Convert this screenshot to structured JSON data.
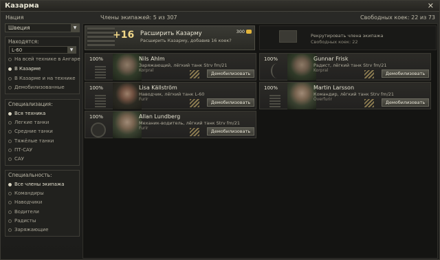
{
  "window": {
    "title": "Казарма",
    "close": "✕"
  },
  "header": {
    "nation_label": "Нация",
    "crew_count": "Члены экипажей: 5 из 307",
    "free_bunks": "Свободных коек: 22 из 73"
  },
  "nation_select": {
    "value": "Швеция",
    "arrow": "▼"
  },
  "location": {
    "title": "Находятся:",
    "select_value": "L-60",
    "select_arrow": "▼",
    "options": [
      "На всей технике в Ангаре",
      "В Казарме",
      "В Казарме и на технике",
      "Демобилизованные"
    ],
    "selected_index": 1
  },
  "specialization": {
    "title": "Специализация:",
    "options": [
      "Вся техника",
      "Легкие танки",
      "Средние танки",
      "Тяжёлые танки",
      "ПТ-САУ",
      "САУ"
    ],
    "selected_index": 0
  },
  "specialty": {
    "title": "Специальность:",
    "options": [
      "Все члены экипажа",
      "Командиры",
      "Наводчики",
      "Водители",
      "Радисты",
      "Заряжающие"
    ],
    "selected_index": 0
  },
  "expand": {
    "plus": "+16",
    "title": "Расширить Казарму",
    "subtitle": "Расширить Казарму, добавив 16 коек?",
    "price": "300"
  },
  "recruit": {
    "title": "Рекрутировать члена экипажа",
    "subtitle": "Свободных коек: 22"
  },
  "crew": [
    {
      "pct": "100%",
      "name": "Nils Ahlm",
      "role": "Заряжающий, лёгкий танк Strv fm/21",
      "rank": "Korpral",
      "button": "Демобилизовать"
    },
    {
      "pct": "100%",
      "name": "Gunnar Frisk",
      "role": "Радист, лёгкий танк Strv fm/21",
      "rank": "Korpral",
      "button": "Демобилизовать"
    },
    {
      "pct": "100%",
      "name": "Lisa Källström",
      "role": "Наводчик, лёгкий танк L-60",
      "rank": "Furir",
      "button": "Демобилизовать"
    },
    {
      "pct": "100%",
      "name": "Martin Larsson",
      "role": "Командир, лёгкий танк Strv fm/21",
      "rank": "Överfurir",
      "button": "Демобилизовать"
    },
    {
      "pct": "100%",
      "name": "Allan Lundberg",
      "role": "Механик-водитель, лёгкий танк Strv fm/21",
      "rank": "Furir",
      "button": "Демобилизовать"
    }
  ]
}
